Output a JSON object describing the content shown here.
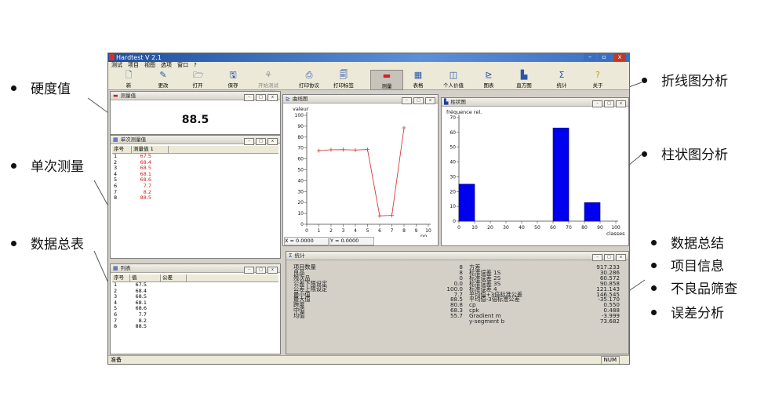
{
  "callouts_left": [
    "硬度值",
    "单次测量",
    "数据总表"
  ],
  "callouts_right": [
    "折线图分析",
    "柱状图分析"
  ],
  "callouts_right_list": [
    "数据总结",
    "项目信息",
    "不良品筛查",
    "误差分析"
  ],
  "app": {
    "title": "Hardtest V 2.1",
    "menu": [
      "测试",
      "项目",
      "视图",
      "选项",
      "窗口",
      "?"
    ],
    "toolbar": [
      {
        "label": "新",
        "icon": "new-file-icon",
        "state": "normal"
      },
      {
        "label": "更改",
        "icon": "edit-icon",
        "state": "normal"
      },
      {
        "label": "打开",
        "icon": "open-folder-icon",
        "state": "normal"
      },
      {
        "label": "保存",
        "icon": "save-icon",
        "state": "normal"
      },
      {
        "label": "开始测试 (F10)",
        "icon": "start-test-icon",
        "state": "disabled"
      },
      {
        "label": "打印协议",
        "icon": "print-icon",
        "state": "normal"
      },
      {
        "label": "打印标签",
        "icon": "print-label-icon",
        "state": "normal"
      },
      {
        "label": "测量",
        "icon": "measure-icon",
        "state": "selected"
      },
      {
        "label": "表格",
        "icon": "table-icon",
        "state": "normal"
      },
      {
        "label": "个人价值",
        "icon": "personal-value-icon",
        "state": "normal"
      },
      {
        "label": "图表",
        "icon": "chart-icon",
        "state": "normal"
      },
      {
        "label": "直方图",
        "icon": "histogram-icon",
        "state": "normal"
      },
      {
        "label": "统计",
        "icon": "statistics-icon",
        "state": "normal"
      },
      {
        "label": "关于",
        "icon": "about-icon",
        "state": "normal"
      }
    ],
    "status_left": "准备",
    "status_right": "NUM"
  },
  "measurement_panel": {
    "title": "测量值",
    "value": "88.5"
  },
  "single_panel": {
    "title": "单次测量值",
    "headers": [
      "序号",
      "测量值 1"
    ],
    "rows": [
      [
        "1",
        "67.5"
      ],
      [
        "2",
        "68.4"
      ],
      [
        "3",
        "68.5"
      ],
      [
        "4",
        "68.1"
      ],
      [
        "5",
        "68.6"
      ],
      [
        "6",
        "7.7"
      ],
      [
        "7",
        "8.2"
      ],
      [
        "8",
        "88.5"
      ]
    ]
  },
  "list_panel": {
    "title": "列表",
    "headers": [
      "序号",
      "值",
      "公差"
    ],
    "rows": [
      [
        "1",
        "67.5"
      ],
      [
        "2",
        "68.4"
      ],
      [
        "3",
        "68.5"
      ],
      [
        "4",
        "68.1"
      ],
      [
        "5",
        "68.6"
      ],
      [
        "6",
        "7.7"
      ],
      [
        "7",
        "8.2"
      ],
      [
        "8",
        "88.5"
      ]
    ]
  },
  "line_panel": {
    "title": "曲线图",
    "x_readout": "X = 0.0000",
    "y_readout": "Y = 0.0000"
  },
  "histogram_panel": {
    "title": "柱状图"
  },
  "stats_panel": {
    "title": "统计",
    "col1_labels": [
      "项目数量",
      "良品",
      "残次品",
      "公差下限设定",
      "公差上限设定",
      "最小值",
      "最大值",
      "跨度",
      "中值",
      "均值"
    ],
    "col1_values": [
      "8",
      "8",
      "0",
      "0.0",
      "100.0",
      "7.7",
      "88.5",
      "80.8",
      "68.3",
      "55.7"
    ],
    "col2_labels": [
      "方差",
      "标准误差 1S",
      "标准误差 2S",
      "标准误差 3S",
      "标准误差 4",
      "平均值+3倍标准公差",
      "平均值-3倍标准公差",
      "cp",
      "cpk",
      "Gradient m",
      "y-segment b"
    ],
    "col2_values": [
      "917.233",
      "30.286",
      "60.572",
      "90.858",
      "121.143",
      "146.545",
      "-35.170",
      "0.550",
      "0.488",
      "-3.999",
      "73.682"
    ]
  },
  "chart_data": [
    {
      "type": "line",
      "ylabel": "valeur",
      "xlabel": "no.",
      "x": [
        1,
        2,
        3,
        4,
        5,
        6,
        7,
        8
      ],
      "series": [
        {
          "values": [
            67.5,
            68.4,
            68.5,
            68.1,
            68.6,
            7.7,
            8.2,
            88.5
          ],
          "color": "#d43a3a"
        }
      ],
      "xlim": [
        0,
        10
      ],
      "ylim": [
        0,
        100
      ],
      "x_ticks": [
        0,
        1,
        2,
        3,
        4,
        5,
        6,
        7,
        8,
        9,
        10
      ],
      "y_ticks": [
        0,
        10,
        20,
        30,
        40,
        50,
        60,
        70,
        80,
        90,
        100
      ],
      "grid": false
    },
    {
      "type": "bar",
      "ylabel": "fréquence rel.",
      "xlabel": "classes",
      "bins": [
        [
          0,
          10
        ],
        [
          60,
          70
        ],
        [
          80,
          90
        ]
      ],
      "values": [
        25,
        63,
        12.5
      ],
      "color": "#0000ee",
      "xlim": [
        0,
        100
      ],
      "ylim": [
        0,
        70
      ],
      "x_ticks": [
        0,
        10,
        20,
        30,
        40,
        50,
        60,
        70,
        80,
        90,
        100
      ],
      "y_ticks": [
        0,
        10,
        20,
        30,
        40,
        50,
        60,
        70
      ],
      "grid": false
    }
  ]
}
